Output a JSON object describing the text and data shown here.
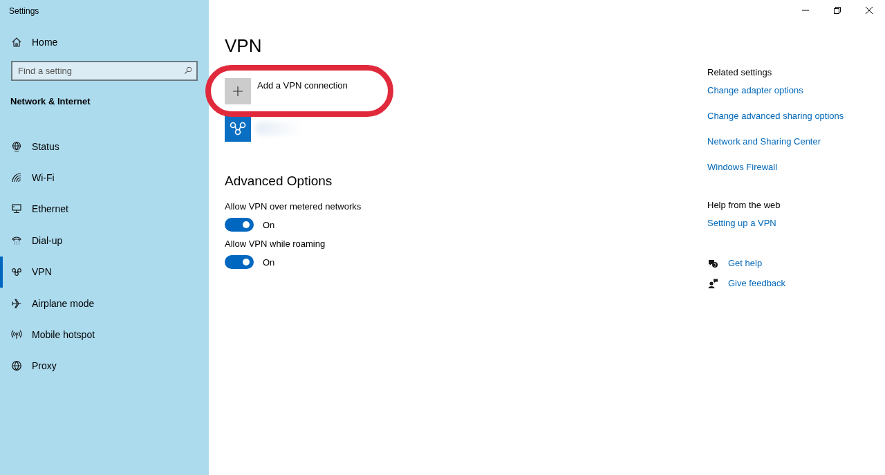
{
  "window": {
    "title": "Settings"
  },
  "sidebar": {
    "home": {
      "label": "Home"
    },
    "search": {
      "placeholder": "Find a setting"
    },
    "section": "Network & Internet",
    "items": [
      {
        "label": "Status",
        "kind": "status",
        "selected": false
      },
      {
        "label": "Wi-Fi",
        "kind": "wifi",
        "selected": false
      },
      {
        "label": "Ethernet",
        "kind": "ethernet",
        "selected": false
      },
      {
        "label": "Dial-up",
        "kind": "dialup",
        "selected": false
      },
      {
        "label": "VPN",
        "kind": "vpn",
        "selected": true
      },
      {
        "label": "Airplane mode",
        "kind": "airplane",
        "selected": false
      },
      {
        "label": "Mobile hotspot",
        "kind": "hotspot",
        "selected": false
      },
      {
        "label": "Proxy",
        "kind": "proxy",
        "selected": false
      }
    ]
  },
  "main": {
    "title": "VPN",
    "add_connection": {
      "label": "Add a VPN connection"
    },
    "advanced": {
      "heading": "Advanced Options",
      "options": [
        {
          "label": "Allow VPN over metered networks",
          "on": true,
          "state_text": "On"
        },
        {
          "label": "Allow VPN while roaming",
          "on": true,
          "state_text": "On"
        }
      ]
    }
  },
  "related": {
    "heading": "Related settings",
    "links": [
      "Change adapter options",
      "Change advanced sharing options",
      "Network and Sharing Center",
      "Windows Firewall"
    ]
  },
  "web_help": {
    "heading": "Help from the web",
    "links": [
      "Setting up a VPN"
    ]
  },
  "support": [
    {
      "kind": "help",
      "label": "Get help"
    },
    {
      "kind": "feedback",
      "label": "Give feedback"
    }
  ]
}
